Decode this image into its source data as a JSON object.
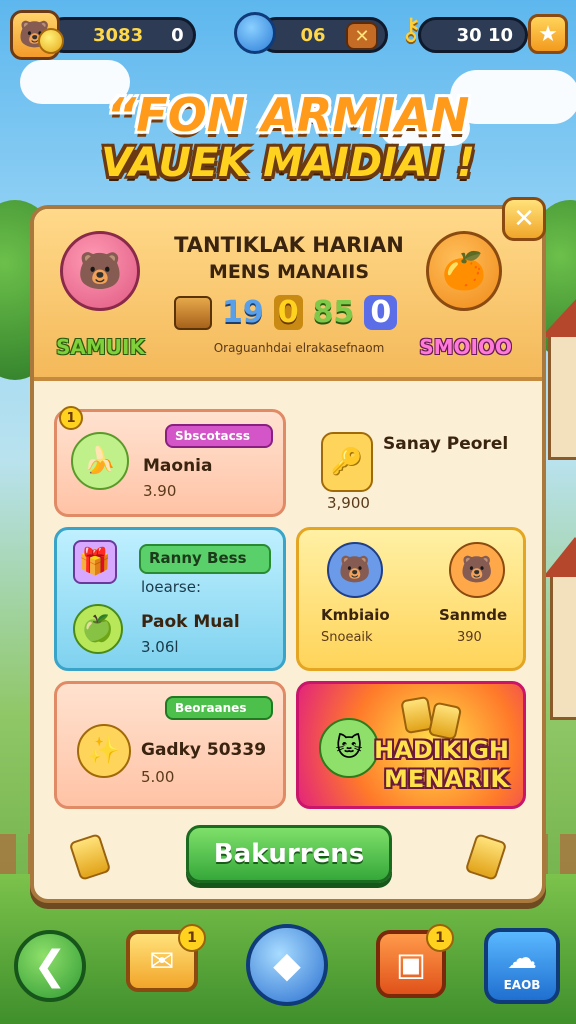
{
  "hud": {
    "coins_a": "3083",
    "coins_b": "0",
    "gems": "06",
    "keys": "30 10",
    "close_symbol": "✕",
    "star_symbol": "★"
  },
  "title": {
    "line1": "“FON ARMIAN",
    "line2": "VAUEK MAIDIAI !"
  },
  "panel": {
    "close_symbol": "✕",
    "heading1": "TANTIKLAK HARIAN",
    "heading2": "MENS MANAIIS",
    "score": [
      "19",
      "0",
      "85",
      "0"
    ],
    "subtitle": "Oraguanhdai elrakasefnaom",
    "left_name": "SAMUIK",
    "right_name": "SMOIOO"
  },
  "cards": [
    {
      "tag": "Sbscotacss",
      "label": "Maonia",
      "value": "3.90",
      "corner": "1"
    },
    {
      "label": "Sanay Peorel",
      "value": "3,900"
    },
    {
      "tag": "Ranny Bess",
      "sub": "loearse:",
      "label": "Paok Mual",
      "value": "3.06l"
    },
    {
      "left_label": "Kmbiaio",
      "left_value": "Snoeaik",
      "right_label": "Sanmde",
      "right_value": "390"
    },
    {
      "tag": "Beoraanes",
      "label": "Gadky 50339",
      "value": "5.00"
    },
    {
      "line1": "HADIKIGH",
      "line2": "MENARIK"
    }
  ],
  "cta_label": "Bakurrens",
  "nav": {
    "back_symbol": "❮",
    "mail_badge": "1",
    "box_badge": "1",
    "cloud_label": "EAOB"
  },
  "colors": {
    "accent_orange": "#ff9a1a",
    "title_yellow": "#ffd21f",
    "cta_green": "#35a83a",
    "panel_bg": "#fbf0d6"
  }
}
